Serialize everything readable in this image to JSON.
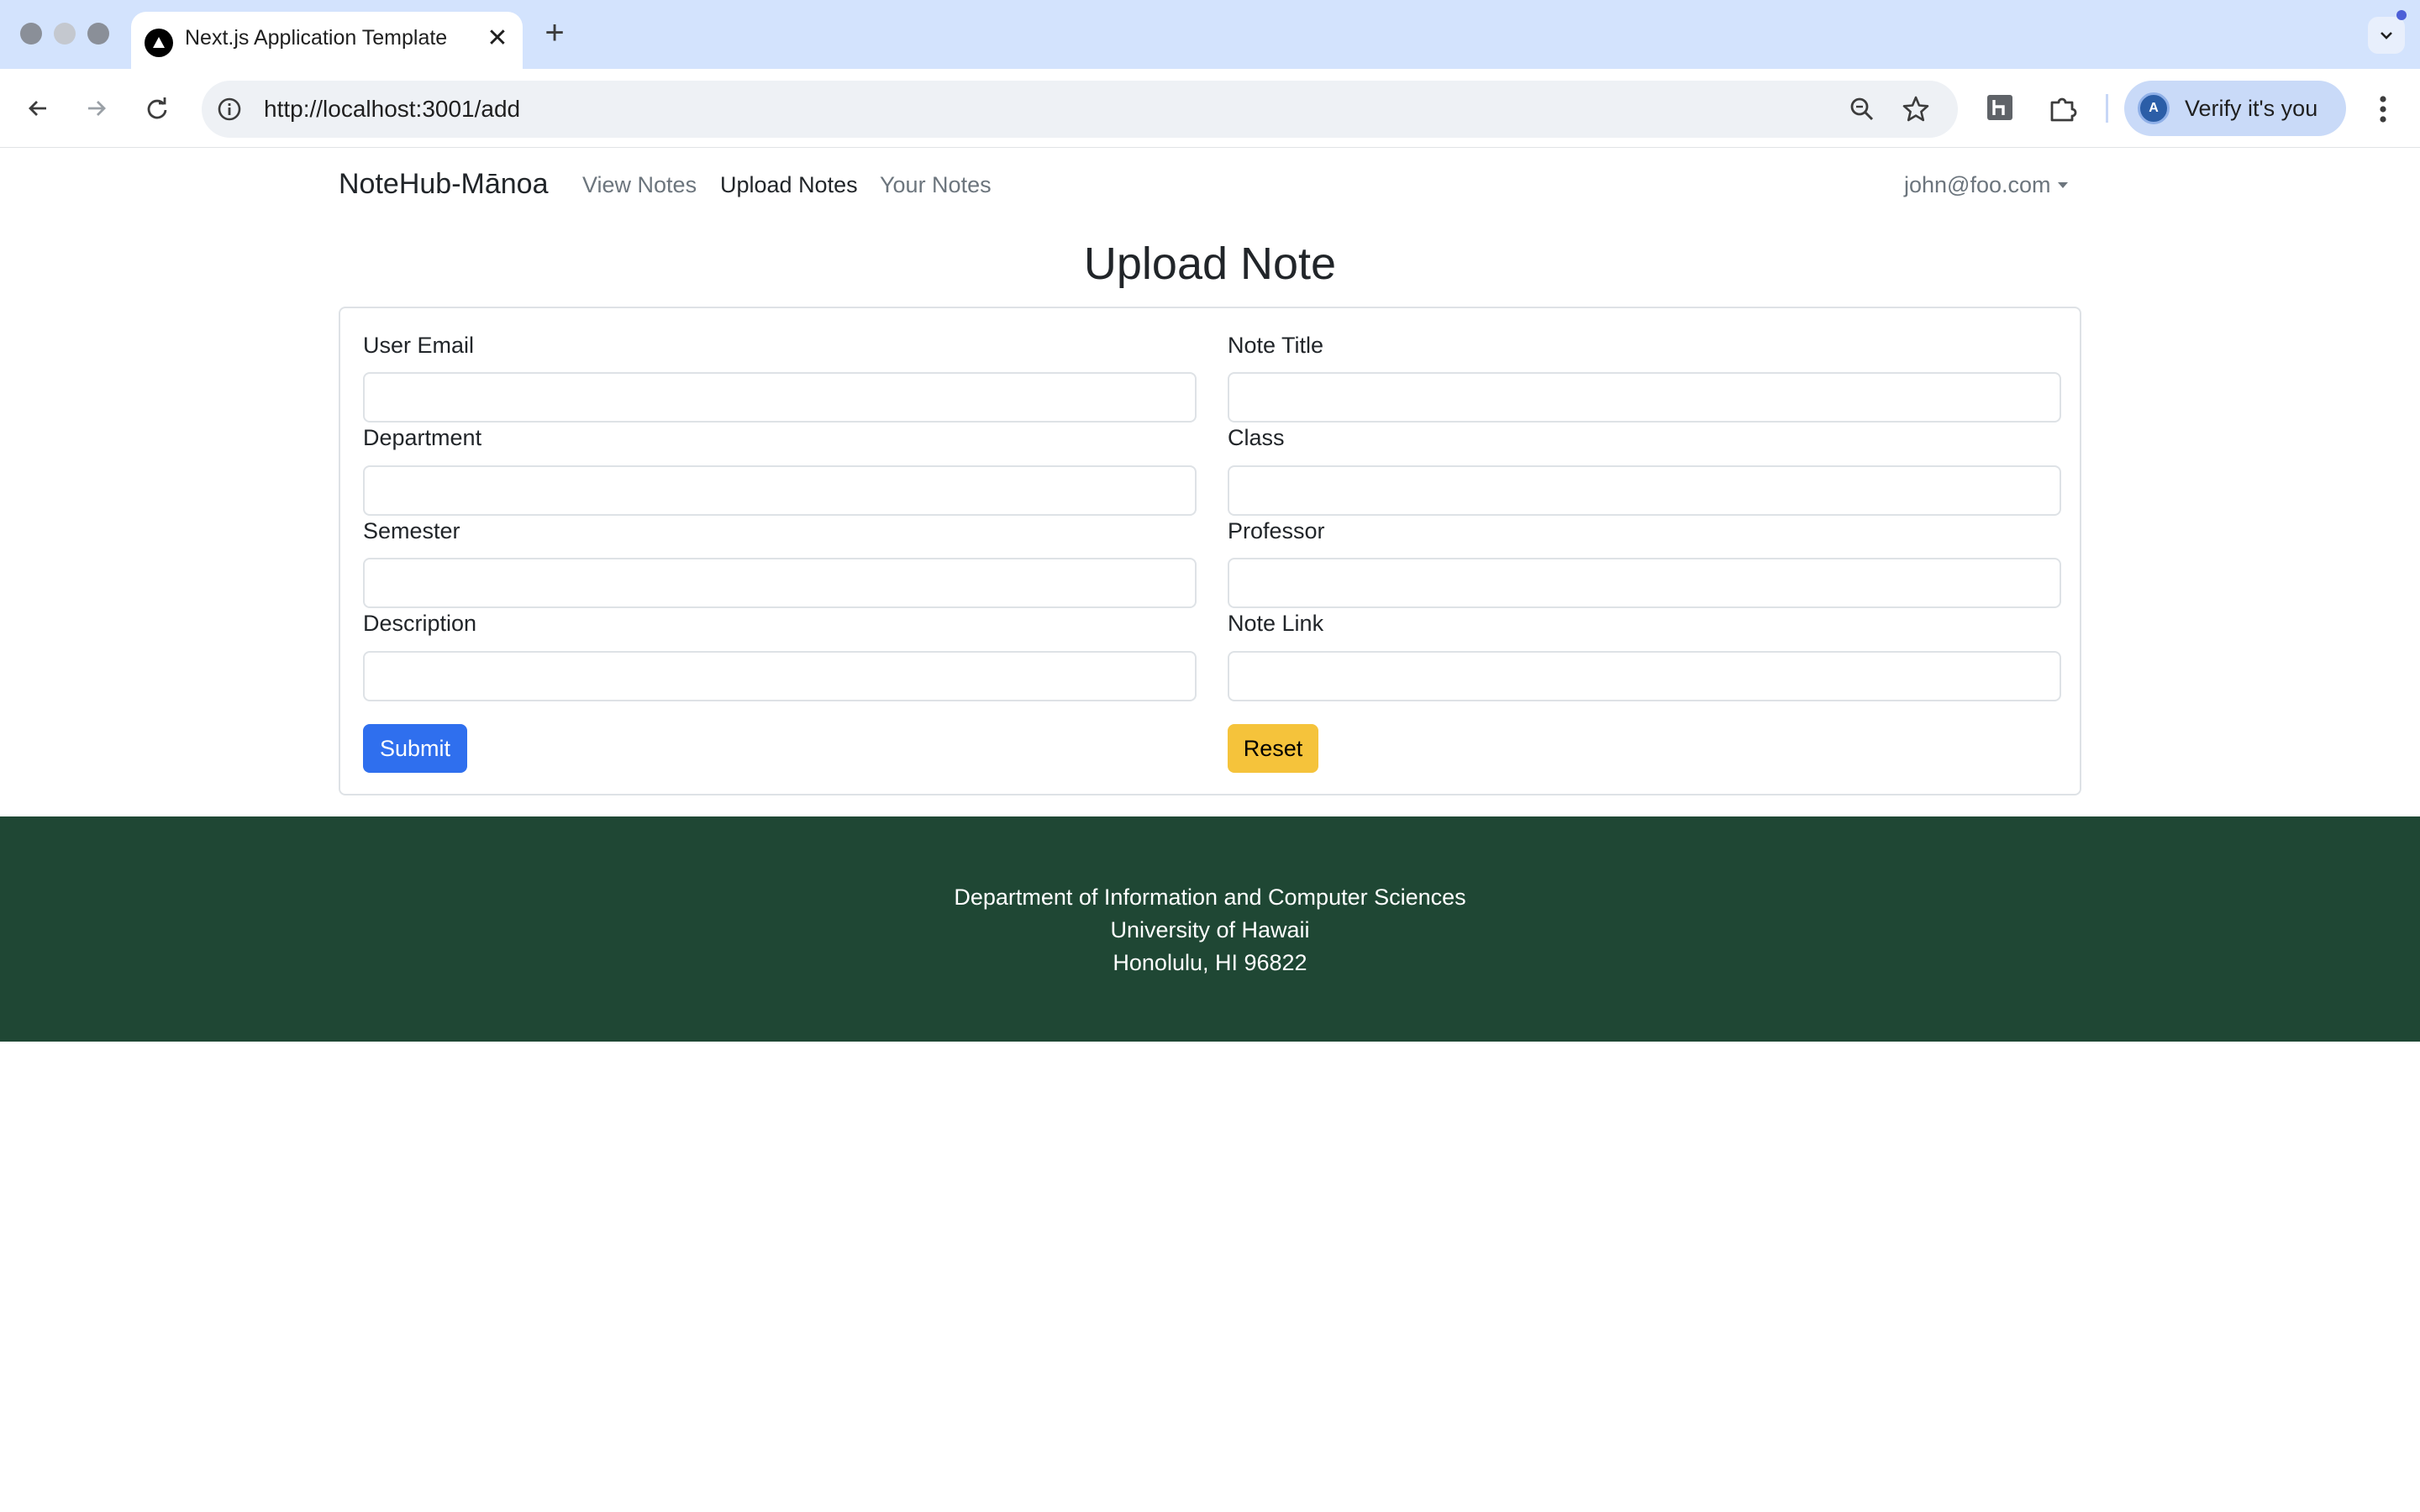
{
  "browser": {
    "tab_title": "Next.js Application Template",
    "url": "http://localhost:3001/add",
    "verify_label": "Verify it's you",
    "avatar_letter": "A"
  },
  "navbar": {
    "brand": "NoteHub-Mānoa",
    "links": [
      {
        "label": "View Notes",
        "active": false
      },
      {
        "label": "Upload Notes",
        "active": true
      },
      {
        "label": "Your Notes",
        "active": false
      }
    ],
    "user": "john@foo.com"
  },
  "form": {
    "title": "Upload Note",
    "fields": {
      "user_email": {
        "label": "User Email",
        "value": ""
      },
      "note_title": {
        "label": "Note Title",
        "value": ""
      },
      "department": {
        "label": "Department",
        "value": ""
      },
      "class": {
        "label": "Class",
        "value": ""
      },
      "semester": {
        "label": "Semester",
        "value": ""
      },
      "professor": {
        "label": "Professor",
        "value": ""
      },
      "description": {
        "label": "Description",
        "value": ""
      },
      "note_link": {
        "label": "Note Link",
        "value": ""
      }
    },
    "submit_label": "Submit",
    "reset_label": "Reset"
  },
  "footer": {
    "lines": [
      "Department of Information and Computer Sciences",
      "University of Hawaii",
      "Honolulu, HI 96822"
    ]
  },
  "colors": {
    "submit": "#2f6fee",
    "reset": "#f5c33b",
    "footer_bg": "#1f4734",
    "tab_strip": "#d3e3fd"
  }
}
